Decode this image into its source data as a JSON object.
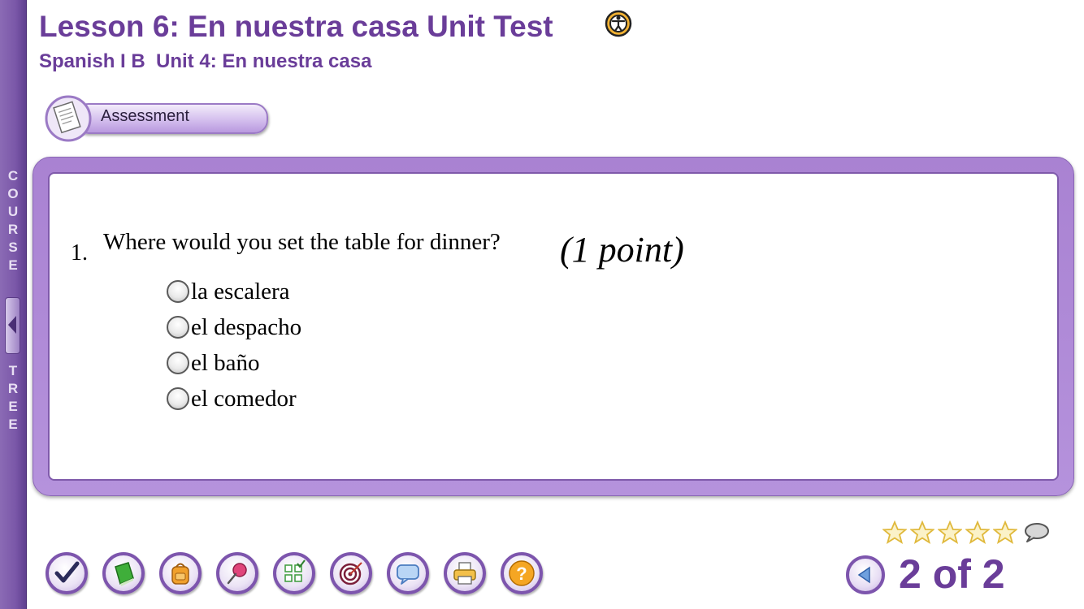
{
  "sidebar": {
    "word_1": "COURSE",
    "word_2": "TREE"
  },
  "header": {
    "title": "Lesson 6: En nuestra casa Unit Test",
    "subtitle": "Spanish I B  Unit 4: En nuestra casa"
  },
  "badge": {
    "label": "Assessment"
  },
  "question": {
    "number": "1.",
    "text": "Where would you set the table for dinner?",
    "points": "(1 point)",
    "options": [
      {
        "label": "la escalera",
        "selected": false
      },
      {
        "label": "el despacho",
        "selected": false
      },
      {
        "label": "el baño",
        "selected": false
      },
      {
        "label": "el comedor",
        "selected": false
      }
    ]
  },
  "rating": {
    "stars_total": 5,
    "stars_filled": 0
  },
  "toolbar": {
    "icons": [
      "check-icon",
      "book-icon",
      "backpack-icon",
      "pushpin-icon",
      "checklist-icon",
      "target-icon",
      "speech-bubble-icon",
      "printer-icon",
      "help-icon"
    ]
  },
  "pagination": {
    "current": "2 of 2"
  },
  "colors": {
    "brand_purple": "#6a3d99",
    "frame_purple": "#a982d2",
    "star_yellow": "#f5d76e"
  }
}
